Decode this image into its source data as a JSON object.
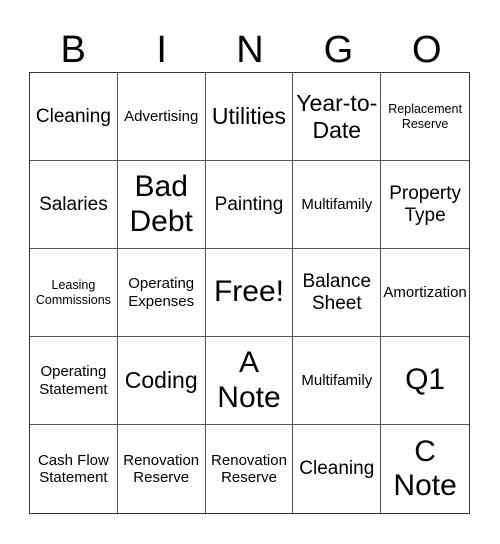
{
  "header": {
    "letters": [
      "B",
      "I",
      "N",
      "G",
      "O"
    ]
  },
  "cells": [
    {
      "text": "Cleaning",
      "size": "s-md"
    },
    {
      "text": "Advertising",
      "size": "s-sm"
    },
    {
      "text": "Utilities",
      "size": "s-lg"
    },
    {
      "text": "Year-to-Date",
      "size": "s-lg"
    },
    {
      "text": "Replacement Reserve",
      "size": "s-xs"
    },
    {
      "text": "Salaries",
      "size": "s-md"
    },
    {
      "text": "Bad Debt",
      "size": "s-xl"
    },
    {
      "text": "Painting",
      "size": "s-md"
    },
    {
      "text": "Multifamily",
      "size": "s-sm"
    },
    {
      "text": "Property Type",
      "size": "s-md"
    },
    {
      "text": "Leasing Commissions",
      "size": "s-xs"
    },
    {
      "text": "Operating Expenses",
      "size": "s-sm"
    },
    {
      "text": "Free!",
      "size": "s-xl"
    },
    {
      "text": "Balance Sheet",
      "size": "s-md"
    },
    {
      "text": "Amortization",
      "size": "s-sm"
    },
    {
      "text": "Operating Statement",
      "size": "s-sm"
    },
    {
      "text": "Coding",
      "size": "s-lg"
    },
    {
      "text": "A Note",
      "size": "s-xl"
    },
    {
      "text": "Multifamily",
      "size": "s-sm"
    },
    {
      "text": "Q1",
      "size": "s-xl"
    },
    {
      "text": "Cash Flow Statement",
      "size": "s-sm"
    },
    {
      "text": "Renovation Reserve",
      "size": "s-sm"
    },
    {
      "text": "Renovation Reserve",
      "size": "s-sm"
    },
    {
      "text": "Cleaning",
      "size": "s-md"
    },
    {
      "text": "C Note",
      "size": "s-xl"
    }
  ]
}
